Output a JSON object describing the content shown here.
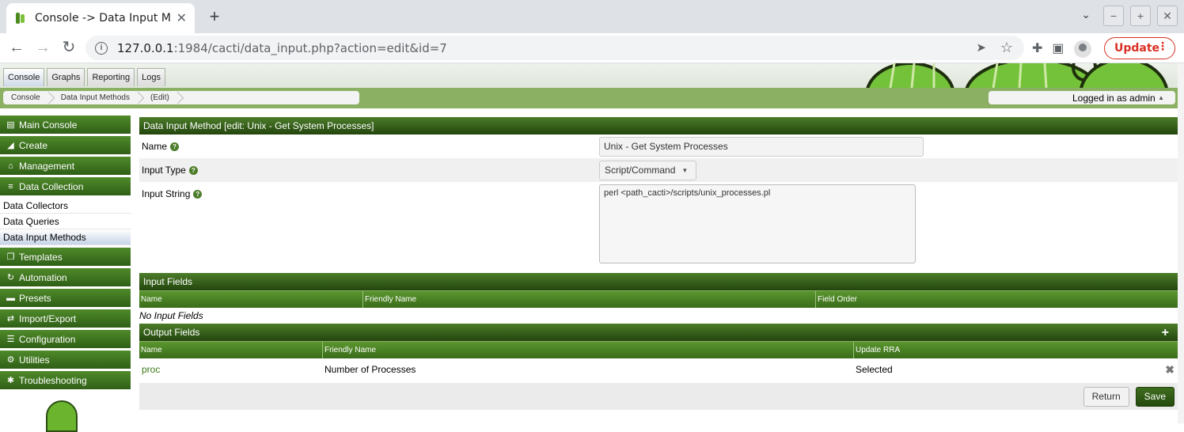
{
  "browser": {
    "tab_title": "Console -> Data Input M",
    "url_host": "127.0.0.1",
    "url_rest": ":1984/cacti/data_input.php?action=edit&id=7",
    "update_label": "Update"
  },
  "cacti": {
    "main_tabs": [
      "Console",
      "Graphs",
      "Reporting",
      "Logs"
    ],
    "breadcrumbs": [
      "Console",
      "Data Input Methods",
      "(Edit)"
    ],
    "logged_in": "Logged in as admin"
  },
  "sidebar": {
    "headers": {
      "main_console": "Main Console",
      "create": "Create",
      "management": "Management",
      "data_collection": "Data Collection",
      "templates": "Templates",
      "automation": "Automation",
      "presets": "Presets",
      "import_export": "Import/Export",
      "configuration": "Configuration",
      "utilities": "Utilities",
      "troubleshooting": "Troubleshooting"
    },
    "data_collection_items": [
      "Data Collectors",
      "Data Queries",
      "Data Input Methods"
    ]
  },
  "form": {
    "title": "Data Input Method [edit: Unix - Get System Processes]",
    "name_label": "Name",
    "name_value": "Unix - Get System Processes",
    "type_label": "Input Type",
    "type_value": "Script/Command",
    "string_label": "Input String",
    "string_value": "perl <path_cacti>/scripts/unix_processes.pl"
  },
  "input_fields": {
    "title": "Input Fields",
    "columns": [
      "Name",
      "Friendly Name",
      "Field Order"
    ],
    "empty_text": "No Input Fields"
  },
  "output_fields": {
    "title": "Output Fields",
    "columns": [
      "Name",
      "Friendly Name",
      "Update RRA"
    ],
    "rows": [
      {
        "name": "proc",
        "friendly": "Number of Processes",
        "update": "Selected"
      }
    ]
  },
  "actions": {
    "return_label": "Return",
    "save_label": "Save"
  }
}
